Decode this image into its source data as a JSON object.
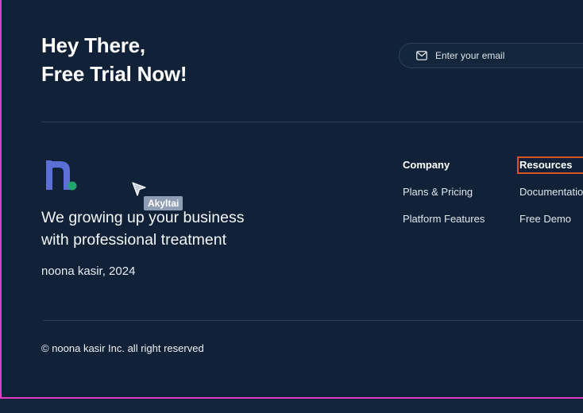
{
  "cta": {
    "headline_line1": "Hey There,",
    "headline_line2": "Free Trial Now!",
    "email_placeholder": "Enter your email"
  },
  "brand": {
    "logo_letter": "n",
    "tagline_line1": "We growing up your business",
    "tagline_line2": "with professional treatment",
    "name_year": "noona kasir, 2024"
  },
  "nav": {
    "columns": [
      {
        "heading": "Company",
        "links": [
          "Plans & Pricing",
          "Platform Features"
        ]
      },
      {
        "heading": "Resources",
        "links": [
          "Documentation",
          "Free Demo"
        ]
      }
    ]
  },
  "footer": {
    "copyright": "© noona kasir Inc. all right reserved"
  },
  "collab_cursor": {
    "label": "Akyltai"
  },
  "colors": {
    "background": "#112238",
    "highlight_outline": "#d9532b",
    "logo_blue": "#5b6fd6",
    "logo_green": "#22a66e",
    "frame_pink": "#e23bc4"
  }
}
